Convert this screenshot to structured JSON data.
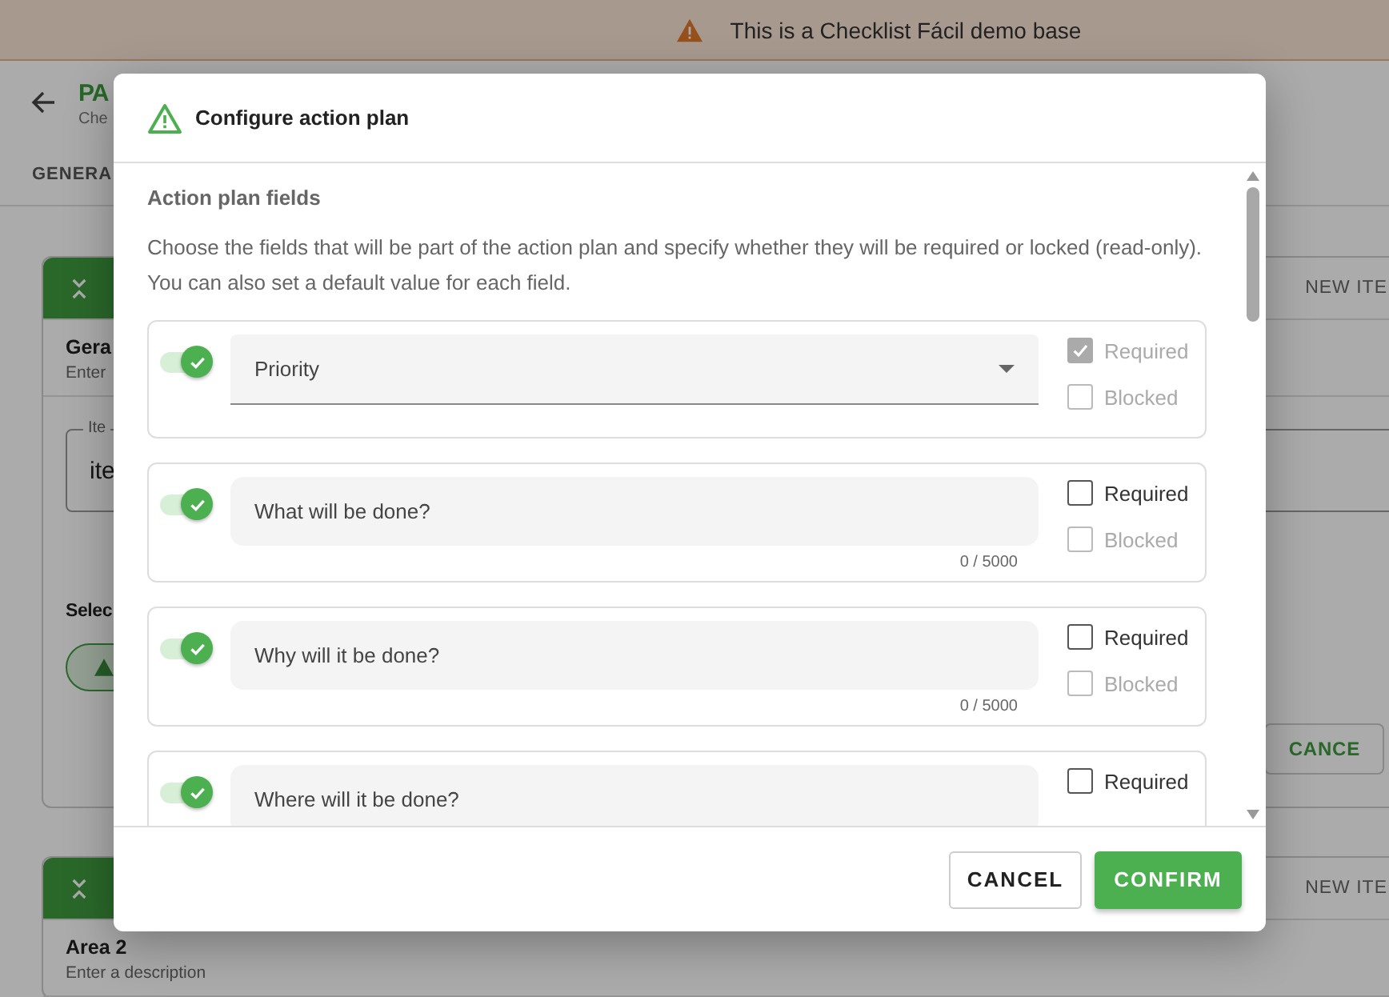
{
  "banner": {
    "text": "This is a Checklist Fácil demo base"
  },
  "page": {
    "title": "PA",
    "subtitle": "Che",
    "tab": "GENERA",
    "sections": [
      {
        "kind": "full",
        "label": "Gera",
        "description": "Enter",
        "new_item": "NEW ITE",
        "field": {
          "label": "Ite",
          "value": "ite"
        },
        "select_label": "Selec",
        "cancel": "CANCE"
      },
      {
        "kind": "collapsed",
        "label": "Area 2",
        "description": "Enter a description",
        "new_item": "NEW ITE"
      }
    ]
  },
  "dialog": {
    "title": "Configure action plan",
    "section_title": "Action plan fields",
    "description": "Choose the fields that will be part of the action plan and specify whether they will be required or locked (read-only). You can also set a default value for each field.",
    "fields": [
      {
        "kind": "select",
        "on": true,
        "label": "Priority",
        "required": {
          "label": "Required",
          "checked": true,
          "disabled": true
        },
        "blocked": {
          "label": "Blocked",
          "checked": false,
          "disabled": true
        }
      },
      {
        "kind": "text",
        "on": true,
        "label": "What will be done?",
        "counter": "0 / 5000",
        "required": {
          "label": "Required",
          "checked": false,
          "disabled": false
        },
        "blocked": {
          "label": "Blocked",
          "checked": false,
          "disabled": true
        }
      },
      {
        "kind": "text",
        "on": true,
        "label": "Why will it be done?",
        "counter": "0 / 5000",
        "required": {
          "label": "Required",
          "checked": false,
          "disabled": false
        },
        "blocked": {
          "label": "Blocked",
          "checked": false,
          "disabled": true
        }
      },
      {
        "kind": "text",
        "on": true,
        "label": "Where will it be done?",
        "required": {
          "label": "Required",
          "checked": false,
          "disabled": false
        }
      }
    ],
    "buttons": {
      "cancel": "CANCEL",
      "confirm": "CONFIRM"
    }
  }
}
